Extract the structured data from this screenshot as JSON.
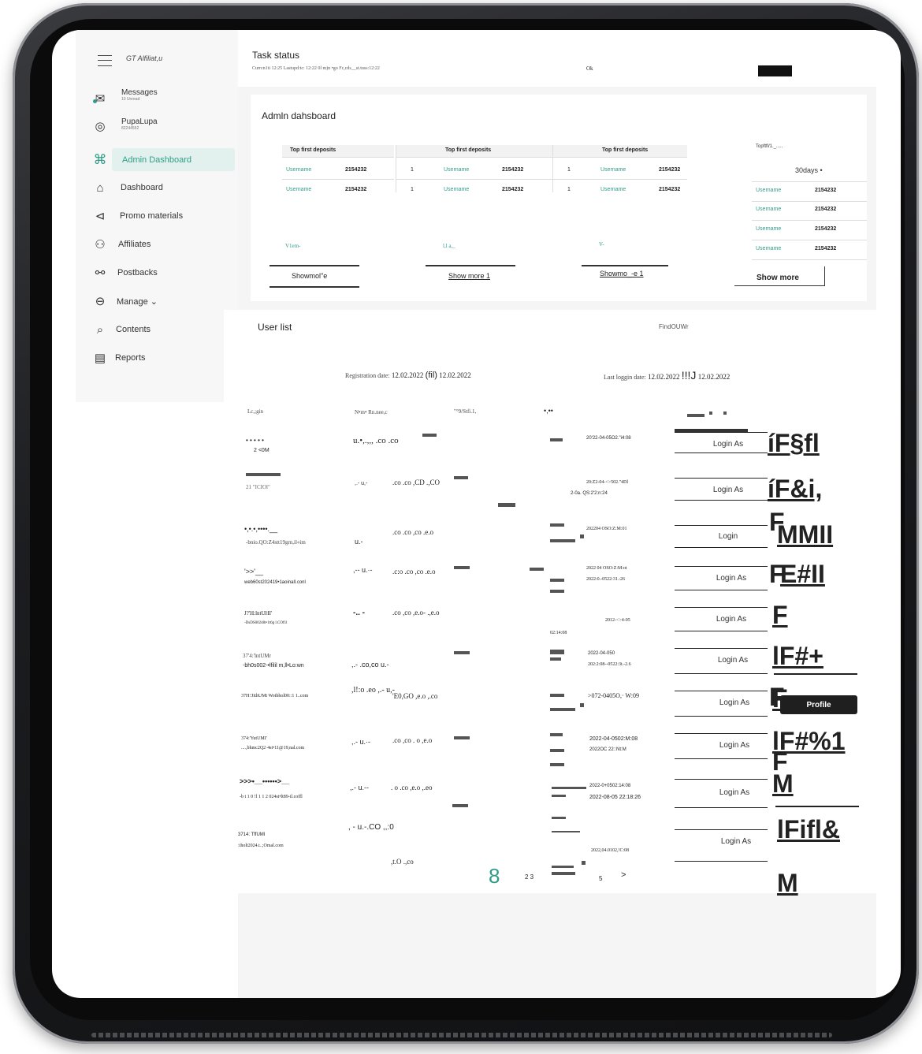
{
  "app": {
    "name": "GT Alfiliat,u"
  },
  "sidebar": {
    "items": [
      {
        "label": "Messages",
        "sub": "10 Unread"
      },
      {
        "label": "PupaLupa",
        "sub": "82244552"
      },
      {
        "label": "Admin Dashboard"
      },
      {
        "label": "Dashboard"
      },
      {
        "label": "Promo materials"
      },
      {
        "label": "Affiliates"
      },
      {
        "label": "Postbacks"
      },
      {
        "label": "Manage ⌄"
      },
      {
        "label": "Contents"
      },
      {
        "label": "Reports"
      }
    ]
  },
  "task": {
    "title": "Task status",
    "meta": "Currcn1ti 12:25 Lastupd:tc: 12:22 0l m)n •go Fc,cds__st.tuss:12:22",
    "status": "Ok"
  },
  "dashboard": {
    "title": "Admln dahsboard",
    "table_head": "Top first deposits",
    "username": "Username",
    "value": "2154232",
    "rank": "1",
    "side_head": "Topftfl/1._.....",
    "period": "30days •",
    "footer_labels": [
      "V1em-",
      "l,l a,_",
      "V-"
    ],
    "show_more": [
      "Showmol\"e",
      "Show more 1",
      "Showmo_-e 1",
      "Show more"
    ]
  },
  "userlist": {
    "title": "User list",
    "find": "FindOUWr",
    "reg_label": "Registration date:",
    "reg_from": "12.02.2022",
    "reg_sep": "(fil)",
    "reg_to": "12.02.2022",
    "last_label": "Last loggin date:",
    "last_from": "12.02.2022",
    "last_sep": "!!!J",
    "last_to": "12.02.2022",
    "col_headers": [
      "Lc,;gin",
      "N•m• Rn.nee,c",
      "\"°9/Stfi.1,",
      "•,••"
    ],
    "rows": [
      {
        "a": "• • • • •",
        "b": "2 <0M",
        "c": "u.•,.,,, .co .co",
        "d": "",
        "e": "20'22-04-05O2.\"i4:08",
        "f": "",
        "btn": "Login As",
        "link": "íF§fl"
      },
      {
        "a": "21 \"ICIOl\"",
        "b": "",
        "c": ",.- u,-",
        "d": ".co .co ,CD .,CO",
        "e": "20:Z2-04-<>502.\"4Dl",
        "f": "2-0a. QS:2'2:n:24",
        "btn": "Login As",
        "link": "íF&i,"
      },
      {
        "a": "•,•.•,••••.__",
        "b": "-bnio.QO:Z4stt19grn,il«im",
        "c": "u.-",
        "d": ".co .co ,co .e.o",
        "e": "202204 OSO:Z:M:01",
        "f": "",
        "btn": "Login",
        "link": "MMII"
      },
      {
        "a": "'>>'__",
        "b": "web60st202419•1aoinall.conl",
        "c": ",-- u.·-",
        "d": ".c:o .co ,co .e.o",
        "e": "2022 04 OSO:Z:M:ot",
        "f": "2022:0.-0522:31.:26",
        "btn": "Login As",
        "link": "E#II"
      },
      {
        "a": "J?'H:lntUHI'",
        "b": "-DsDS00248t•1t6g l.COf1l",
        "c": "-.. -",
        "d": ".co ,co ,e.o- .,e.o",
        "e": "2012-<>4-05",
        "f": "02:14:08",
        "btn": "Login As",
        "link": "F"
      },
      {
        "a": "37'4:'lntUMr",
        "b": "-bh0s002-•lfilil m,ll•Lo:wn",
        "c": ",.- .co,co u.-",
        "d": "",
        "e": "2022-04-050",
        "f": "202:2:08--0522:3t.-2.6",
        "btn": "Login As",
        "link": "lF#+"
      },
      {
        "a": "37H:'JithUMt Wotbhol00::1 1..com",
        "b": "",
        "c": ",l!:o .eo ,.- u,-",
        "d": "'E0,GO ,e.o ,.co",
        "e": ">072-0405O,· W:09",
        "f": "",
        "btn": "Login As",
        "link": "F"
      },
      {
        "a": "374:'YutUMI'",
        "b": "....,bhmc2Q2·4st•11@19,nal.com",
        "c": ",.- u.·-",
        "d": ".co ,co . o ,e.o",
        "e": "2022-04-0502:M:08",
        "f": "2022OC 22::Nt:M",
        "btn": "Login As",
        "link": "lF#%1"
      },
      {
        "a": ">>>•__••••••>__",
        "b": "-b t 1 0 !l 1 1 2 024st•lt89-il.coffl",
        "c": ",.- u.--",
        "d": ". o .co ,e.o ,.eo",
        "e": "2022-0+0502:14:08",
        "f": "2022-08-05 22:18:26",
        "btn": "Login As",
        "link": "M"
      },
      {
        "a": "3714: TffUMI",
        "b": ":iholt2024.t..;Omal.com",
        "c": ", - u.-.CO ,,:0",
        "d": ",t.O .,co",
        "e": "2022,04.0102,!C:08",
        "f": "",
        "btn": "Login As",
        "link": "lFifl&"
      }
    ],
    "profile": "Profile",
    "pager": {
      "current": "8",
      "pages": "2 3",
      "p5": "5",
      "next": ">"
    },
    "extra_links": [
      "F",
      "F",
      "F",
      "F",
      "M"
    ]
  }
}
